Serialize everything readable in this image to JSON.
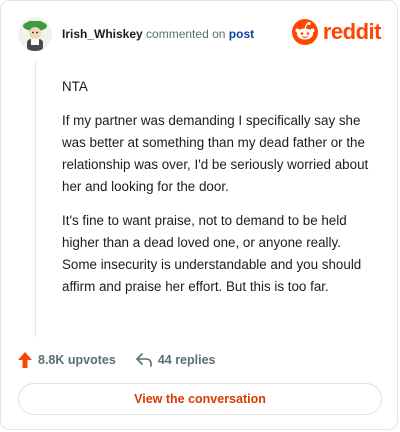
{
  "header": {
    "username": "Irish_Whiskey",
    "action_text": "commented on",
    "post_link": "post",
    "brand": "reddit"
  },
  "comment": {
    "paragraphs": [
      "NTA",
      "If my partner was demanding I specifically say she was better at something than my dead father or the relationship was over, I'd be seriously worried about her and looking for the door.",
      "It's fine to want praise, not to demand to be held higher than a dead loved one, or anyone really. Some insecurity is understandable and you should affirm and praise her effort. But this is too far."
    ]
  },
  "stats": {
    "upvotes": "8.8K upvotes",
    "replies": "44 replies"
  },
  "cta": {
    "label": "View the conversation"
  },
  "colors": {
    "brand": "#ff4500",
    "link": "#0a449b",
    "cta_text": "#d93a00",
    "muted": "#576f76"
  }
}
